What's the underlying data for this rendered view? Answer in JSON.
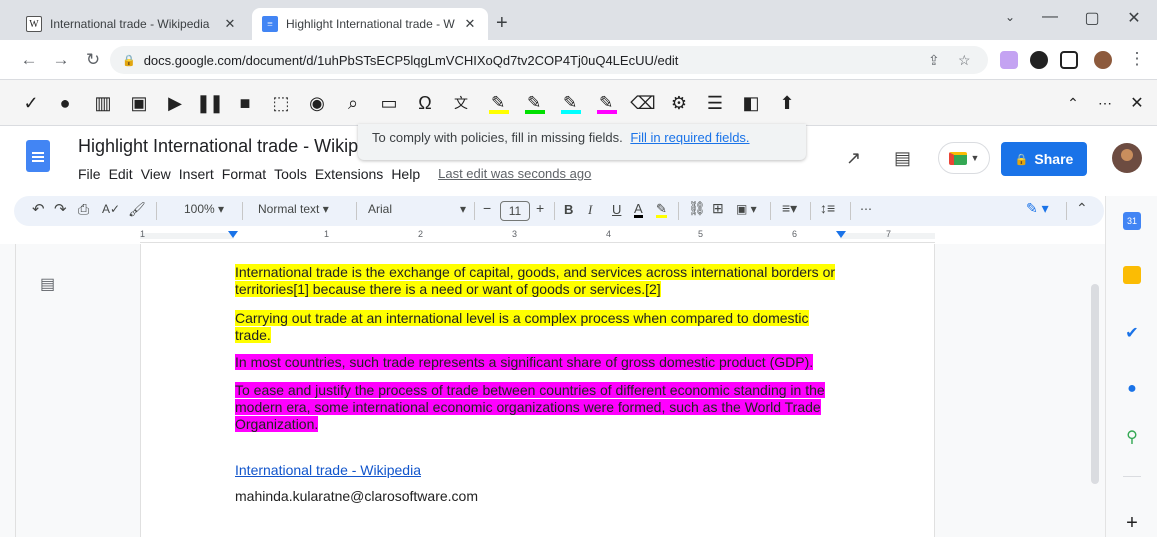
{
  "browser": {
    "tabs": [
      {
        "label": "International trade - Wikipedia",
        "favicon": "W",
        "active": false
      },
      {
        "label": "Highlight International trade - W",
        "favicon": "docs",
        "active": true
      }
    ],
    "new_tab": "+",
    "window_controls": [
      "⌄",
      "—",
      "▢",
      "✕"
    ],
    "url": "docs.google.com/document/d/1uhPbSTsECP5lqgLmVCHIXoQd7tv2COP4Tj0uQ4LEcUU/edit"
  },
  "ext_toolbar": {
    "highlight_colors": [
      "#ffff00",
      "#00e000",
      "#00ffff",
      "#ff00ff"
    ]
  },
  "docs": {
    "title": "Highlight International trade - Wikipe",
    "menus": [
      "File",
      "Edit",
      "View",
      "Insert",
      "Format",
      "Tools",
      "Extensions",
      "Help"
    ],
    "last_edit": "Last edit was seconds ago",
    "notice_text": "To comply with policies, fill in missing fields.",
    "notice_link": "Fill in required fields.",
    "share_label": "Share"
  },
  "format_bar": {
    "zoom": "100%",
    "style": "Normal text",
    "font": "Arial",
    "font_size": "11",
    "minus": "−",
    "plus": "+",
    "bold": "B",
    "italic": "I",
    "underline": "U",
    "text_color": "A",
    "more": "⋯"
  },
  "ruler": {
    "numbers": [
      "1",
      "1",
      "2",
      "3",
      "4",
      "5",
      "6",
      "7"
    ]
  },
  "document": {
    "paragraphs": [
      {
        "text": "International trade is the exchange of capital, goods, and services across international borders or territories[1] because there is a need or want of goods or services.[2]",
        "highlight": "#ffff00"
      },
      {
        "text": "Carrying out trade at an international level is a complex process when compared to domestic trade.",
        "highlight": "#ffff00"
      },
      {
        "text": "In most countries, such trade represents a significant share of gross domestic product (GDP).",
        "highlight": "#ff00ff"
      },
      {
        "text": "To ease and justify the process of trade between countries of different economic standing in the modern era, some international economic organizations were formed, such as the World Trade Organization.",
        "highlight": "#ff00ff"
      }
    ],
    "link": "International trade - Wikipedia",
    "email": "mahinda.kularatne@clarosoftware.com"
  },
  "sidebar": {
    "calendar_day": "31",
    "add": "+"
  },
  "colors": {
    "accent": "#1a73e8",
    "yellow_highlight": "#ffff00",
    "magenta_highlight": "#ff00ff"
  }
}
